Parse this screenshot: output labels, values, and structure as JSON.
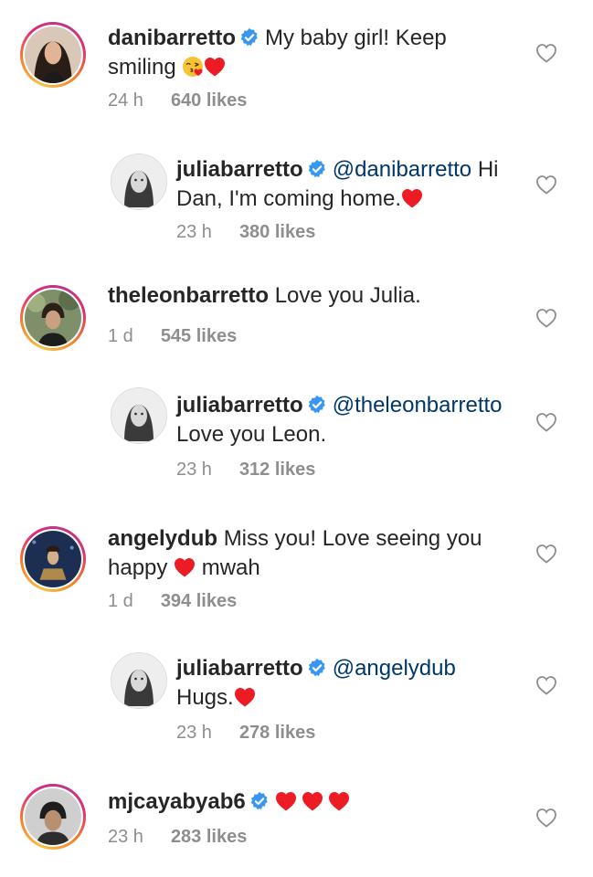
{
  "comments": [
    {
      "user": "danibarretto",
      "text1": "My baby girl! Keep",
      "text2": "smiling",
      "time": "24 h",
      "likes": "640 likes"
    },
    {
      "user": "juliabarretto",
      "mention": "@danibarretto",
      "text1": "Hi",
      "text2": "Dan, I'm coming home.",
      "time": "23 h",
      "likes": "380 likes"
    },
    {
      "user": "theleonbarretto",
      "text1": "Love you Julia.",
      "time": "1 d",
      "likes": "545 likes"
    },
    {
      "user": "juliabarretto",
      "mention": "@theleonbarretto",
      "text2": "Love you Leon.",
      "time": "23 h",
      "likes": "312 likes"
    },
    {
      "user": "angelydub",
      "text1": "Miss you! Love seeing you",
      "text2a": "happy",
      "text2b": "mwah",
      "time": "1 d",
      "likes": "394 likes"
    },
    {
      "user": "juliabarretto",
      "mention": "@angelydub",
      "text2": "Hugs.",
      "time": "23 h",
      "likes": "278 likes"
    },
    {
      "user": "mjcayabyab6",
      "time": "23 h",
      "likes": "283 likes"
    }
  ],
  "icons": {
    "verified": "verified-badge-icon",
    "like": "heart-outline-icon",
    "emoji_heart": "red-heart-emoji",
    "emoji_kiss": "face-blowing-kiss-emoji"
  },
  "colors": {
    "verified": "#3897f0",
    "mention": "#00376b",
    "muted": "#8e8e8e",
    "heart": "#ed1c24"
  }
}
